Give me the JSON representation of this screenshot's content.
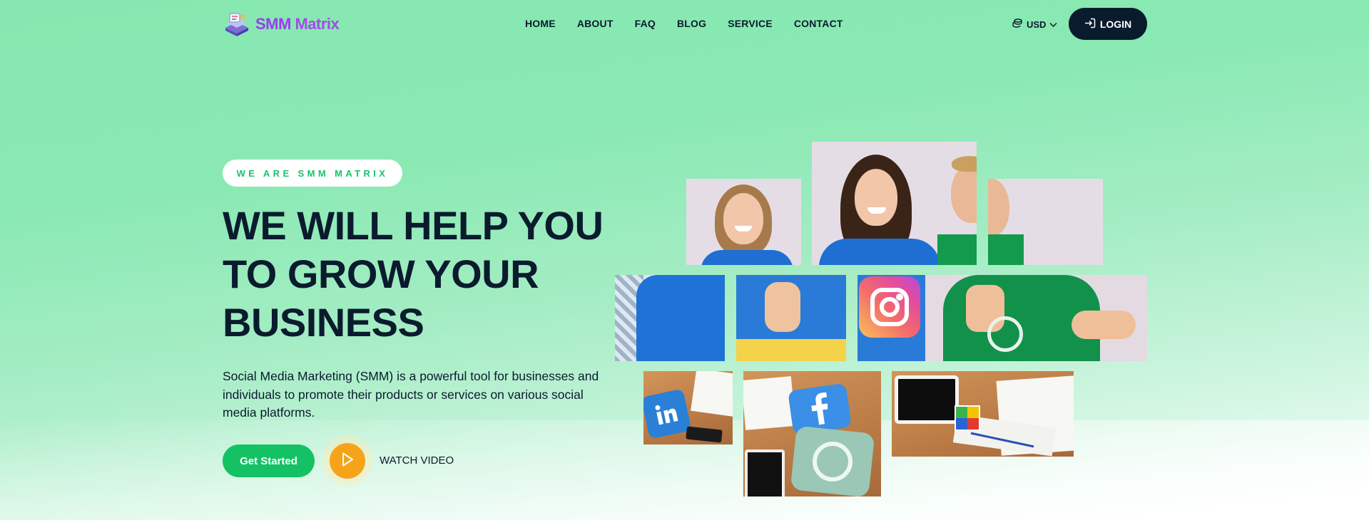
{
  "header": {
    "logo_text_a": "SMM",
    "logo_text_b": "Matrix",
    "nav": [
      "HOME",
      "ABOUT",
      "FAQ",
      "BLOG",
      "SERVICE",
      "CONTACT"
    ],
    "currency": "USD",
    "login_label": "LOGIN"
  },
  "hero": {
    "tagline": "WE ARE SMM MATRIX",
    "headline": "WE WILL HELP YOU TO GROW YOUR BUSINESS",
    "description": "Social Media Marketing (SMM) is a powerful tool for businesses and individuals to promote their products or services on various social media platforms.",
    "cta_label": "Get Started",
    "video_label": "WATCH VIDEO"
  },
  "colors": {
    "brand_green": "#14c265",
    "dark_navy": "#0b1b2e",
    "logo_purple": "#9b3cf0",
    "play_orange": "#f7a31a"
  },
  "icons": [
    "logo-icon",
    "coins-icon",
    "chevron-down-icon",
    "login-icon",
    "play-icon",
    "instagram-icon",
    "facebook-icon",
    "linkedin-icon",
    "whatsapp-icon"
  ]
}
